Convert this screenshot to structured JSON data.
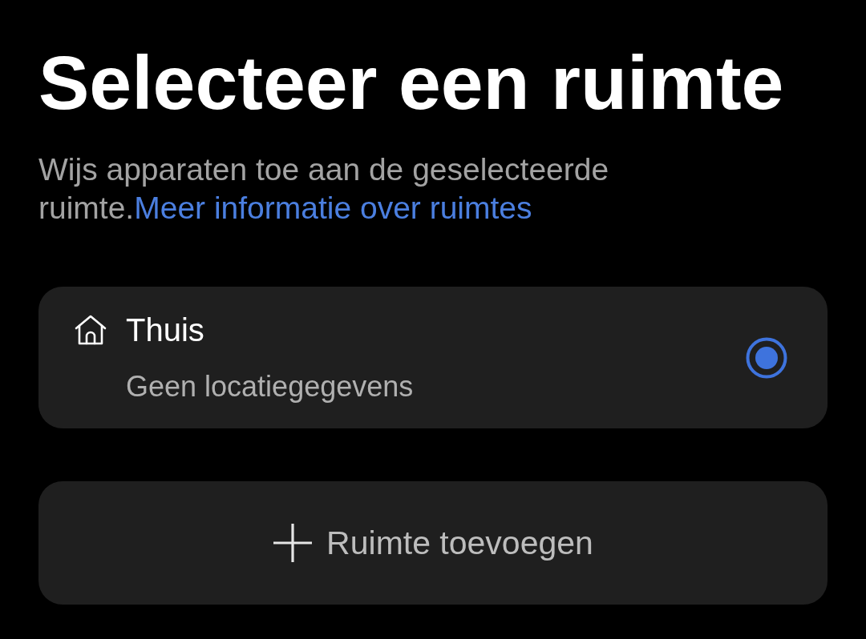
{
  "title": "Selecteer een ruimte",
  "description": {
    "text": "Wijs apparaten toe aan de geselecteerde ruimte.",
    "link": "Meer informatie over ruimtes"
  },
  "rooms": [
    {
      "name": "Thuis",
      "detail": "Geen locatiegegevens",
      "selected": true
    }
  ],
  "add_button": {
    "label": "Ruimte toevoegen"
  }
}
